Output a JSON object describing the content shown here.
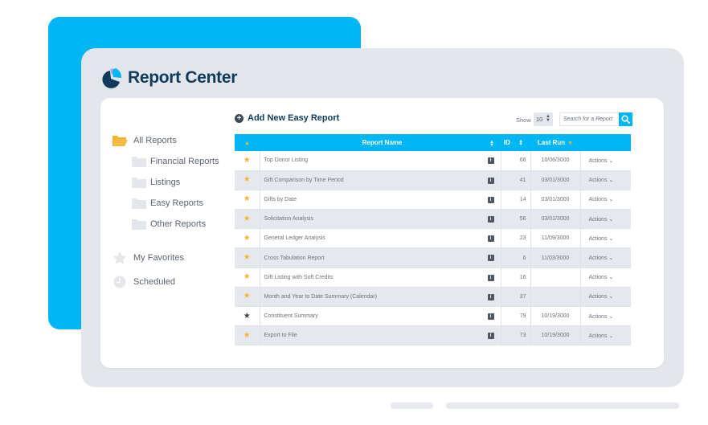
{
  "app": {
    "title": "Report Center"
  },
  "colors": {
    "accent": "#00b6f5",
    "brand_text": "#0f3a5c",
    "star_active": "#f5b431",
    "star_inactive": "#3d4650",
    "logo_purple": "#b9a3e3",
    "logo_blue": "#00b6f5",
    "logo_dark": "#0f3a5c"
  },
  "sidebar": {
    "items": [
      {
        "label": "All Reports",
        "icon": "folder-open-icon"
      },
      {
        "label": "Financial Reports",
        "icon": "folder-icon"
      },
      {
        "label": "Listings",
        "icon": "folder-icon"
      },
      {
        "label": "Easy Reports",
        "icon": "folder-icon"
      },
      {
        "label": "Other Reports",
        "icon": "folder-icon"
      },
      {
        "label": "My  Favorites",
        "icon": "star-icon"
      },
      {
        "label": "Scheduled",
        "icon": "clock-icon"
      }
    ]
  },
  "toolbar": {
    "add_label": "Add New Easy Report",
    "add_icon": "plus-circle-icon",
    "show_label": "Show",
    "show_value": "10",
    "search_placeholder": "Search for a Report",
    "search_icon": "search-icon"
  },
  "table": {
    "headers": {
      "star": "",
      "name": "Report Name",
      "id": "ID",
      "last_run": "Last Run",
      "actions": ""
    },
    "sort_indicator": "sort-icon",
    "rows": [
      {
        "favorite": true,
        "name": "Top Donor Listing",
        "id": "66",
        "last_run": "10/06/3000",
        "actions": "Actions"
      },
      {
        "favorite": true,
        "name": "Gift Comparison by Time Period",
        "id": "41",
        "last_run": "03/01/3000",
        "actions": "Actions"
      },
      {
        "favorite": true,
        "name": "Gifts by Date",
        "id": "14",
        "last_run": "03/01/3000",
        "actions": "Actions"
      },
      {
        "favorite": true,
        "name": "Solicitation Analysis",
        "id": "56",
        "last_run": "03/01/3000",
        "actions": "Actions"
      },
      {
        "favorite": true,
        "name": "General Ledger Analysis",
        "id": "23",
        "last_run": "11/09/3000",
        "actions": "Actions"
      },
      {
        "favorite": true,
        "name": "Cross Tabulation Report",
        "id": "6",
        "last_run": "11/03/3000",
        "actions": "Actions"
      },
      {
        "favorite": true,
        "name": "Gift Listing with Soft Credits",
        "id": "16",
        "last_run": "",
        "actions": "Actions"
      },
      {
        "favorite": true,
        "name": "Month and Year to Date Summary (Calendar)",
        "id": "37",
        "last_run": "",
        "actions": "Actions"
      },
      {
        "favorite": false,
        "name": "Constituent Summary",
        "id": "79",
        "last_run": "10/19/3000",
        "actions": "Actions"
      },
      {
        "favorite": true,
        "name": "Export to File",
        "id": "73",
        "last_run": "10/19/3000",
        "actions": "Actions"
      }
    ]
  }
}
